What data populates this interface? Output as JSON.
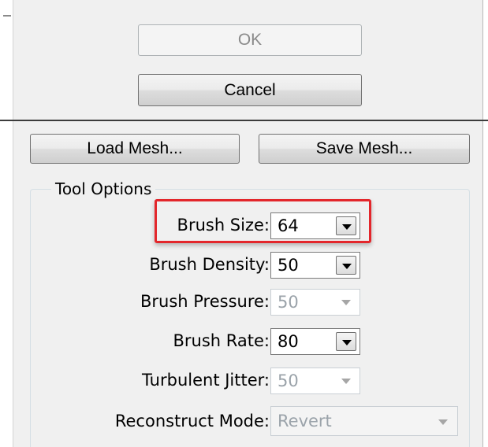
{
  "buttons": {
    "ok": "OK",
    "ok_enabled": false,
    "cancel": "Cancel",
    "load_mesh": "Load Mesh...",
    "save_mesh": "Save Mesh..."
  },
  "tool_options": {
    "title": "Tool Options",
    "highlight_color": "#e3262b",
    "rows": [
      {
        "label": "Brush Size:",
        "value": "64",
        "enabled": true,
        "highlighted": true
      },
      {
        "label": "Brush Density:",
        "value": "50",
        "enabled": true
      },
      {
        "label": "Brush Pressure:",
        "value": "50",
        "enabled": false
      },
      {
        "label": "Brush Rate:",
        "value": "80",
        "enabled": true
      },
      {
        "label": "Turbulent Jitter:",
        "value": "50",
        "enabled": false
      },
      {
        "label": "Reconstruct Mode:",
        "value": "Revert",
        "enabled": false
      }
    ]
  },
  "icons": {
    "dropdown": "chevron-down-icon"
  }
}
